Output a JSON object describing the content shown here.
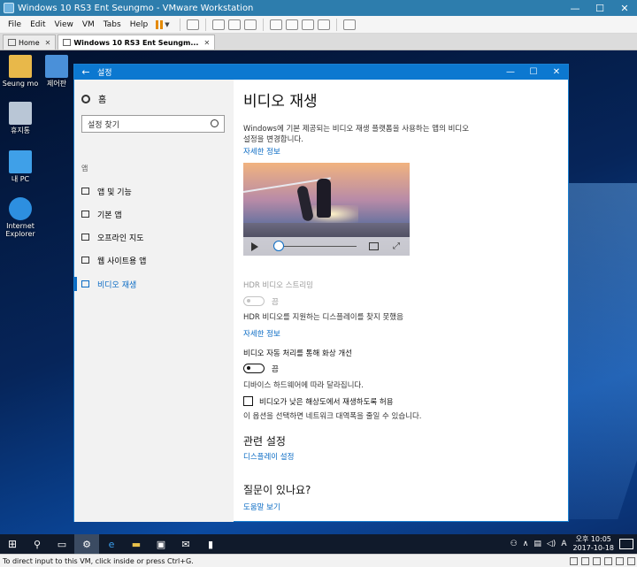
{
  "vmware": {
    "title": "Windows 10 RS3 Ent Seungmo - VMware Workstation",
    "menu": [
      "File",
      "Edit",
      "View",
      "VM",
      "Tabs",
      "Help"
    ],
    "tabs": [
      {
        "label": "Home",
        "active": false
      },
      {
        "label": "Windows 10 RS3 Ent Seungm...",
        "active": true
      }
    ],
    "status_text": "To direct input to this VM, click inside or press Ctrl+G."
  },
  "desktop": {
    "icons": [
      {
        "label": "Seung mo",
        "icon": "user-folder-icon",
        "color": "#e8b84a"
      },
      {
        "label": "제어판",
        "icon": "control-panel-icon",
        "color": "#4a90d9"
      },
      {
        "label": "휴지통",
        "icon": "recycle-bin-icon",
        "color": "#b9c6d6"
      },
      {
        "label": "내 PC",
        "icon": "this-pc-icon",
        "color": "#3fa0e8"
      },
      {
        "label": "Internet Explorer",
        "icon": "ie-icon",
        "color": "#2d8fe0"
      }
    ]
  },
  "settings": {
    "window_title": "설정",
    "nav": {
      "home": "홈",
      "search_placeholder": "설정 찾기",
      "section": "앱",
      "items": [
        {
          "label": "앱 및 기능",
          "icon": "apps-features-icon",
          "active": false
        },
        {
          "label": "기본 앱",
          "icon": "default-apps-icon",
          "active": false
        },
        {
          "label": "오프라인 지도",
          "icon": "offline-maps-icon",
          "active": false
        },
        {
          "label": "웹 사이트용 앱",
          "icon": "apps-websites-icon",
          "active": false
        },
        {
          "label": "비디오 재생",
          "icon": "video-playback-icon",
          "active": true
        }
      ]
    },
    "content": {
      "title": "비디오 재생",
      "description": "Windows에 기본 제공되는 비디오 재생 플랫폼을 사용하는 앱의 비디오 설정을 변경합니다.",
      "more_info_1": "자세한 정보",
      "hdr": {
        "label": "HDR 비디오 스트리밍",
        "state": "끔",
        "note": "HDR 비디오를 지원하는 디스플레이를 찾지 못했음",
        "more_info": "자세한 정보"
      },
      "enhance": {
        "label": "비디오 자동 처리를 통해 화상 개선",
        "state": "끔",
        "note": "디바이스 하드웨어에 따라 달라집니다."
      },
      "low_res": {
        "label": "비디오가 낮은 해상도에서 재생하도록 허용",
        "note": "이 옵션을 선택하면 네트워크 대역폭을 줄일 수 있습니다."
      },
      "related_title": "관련 설정",
      "related_link": "디스플레이 설정",
      "question_title": "질문이 있나요?",
      "help_link": "도움말 보기"
    }
  },
  "taskbar": {
    "time": "오후 10:05",
    "date": "2017-10-18",
    "accent": "#0c78d0"
  }
}
